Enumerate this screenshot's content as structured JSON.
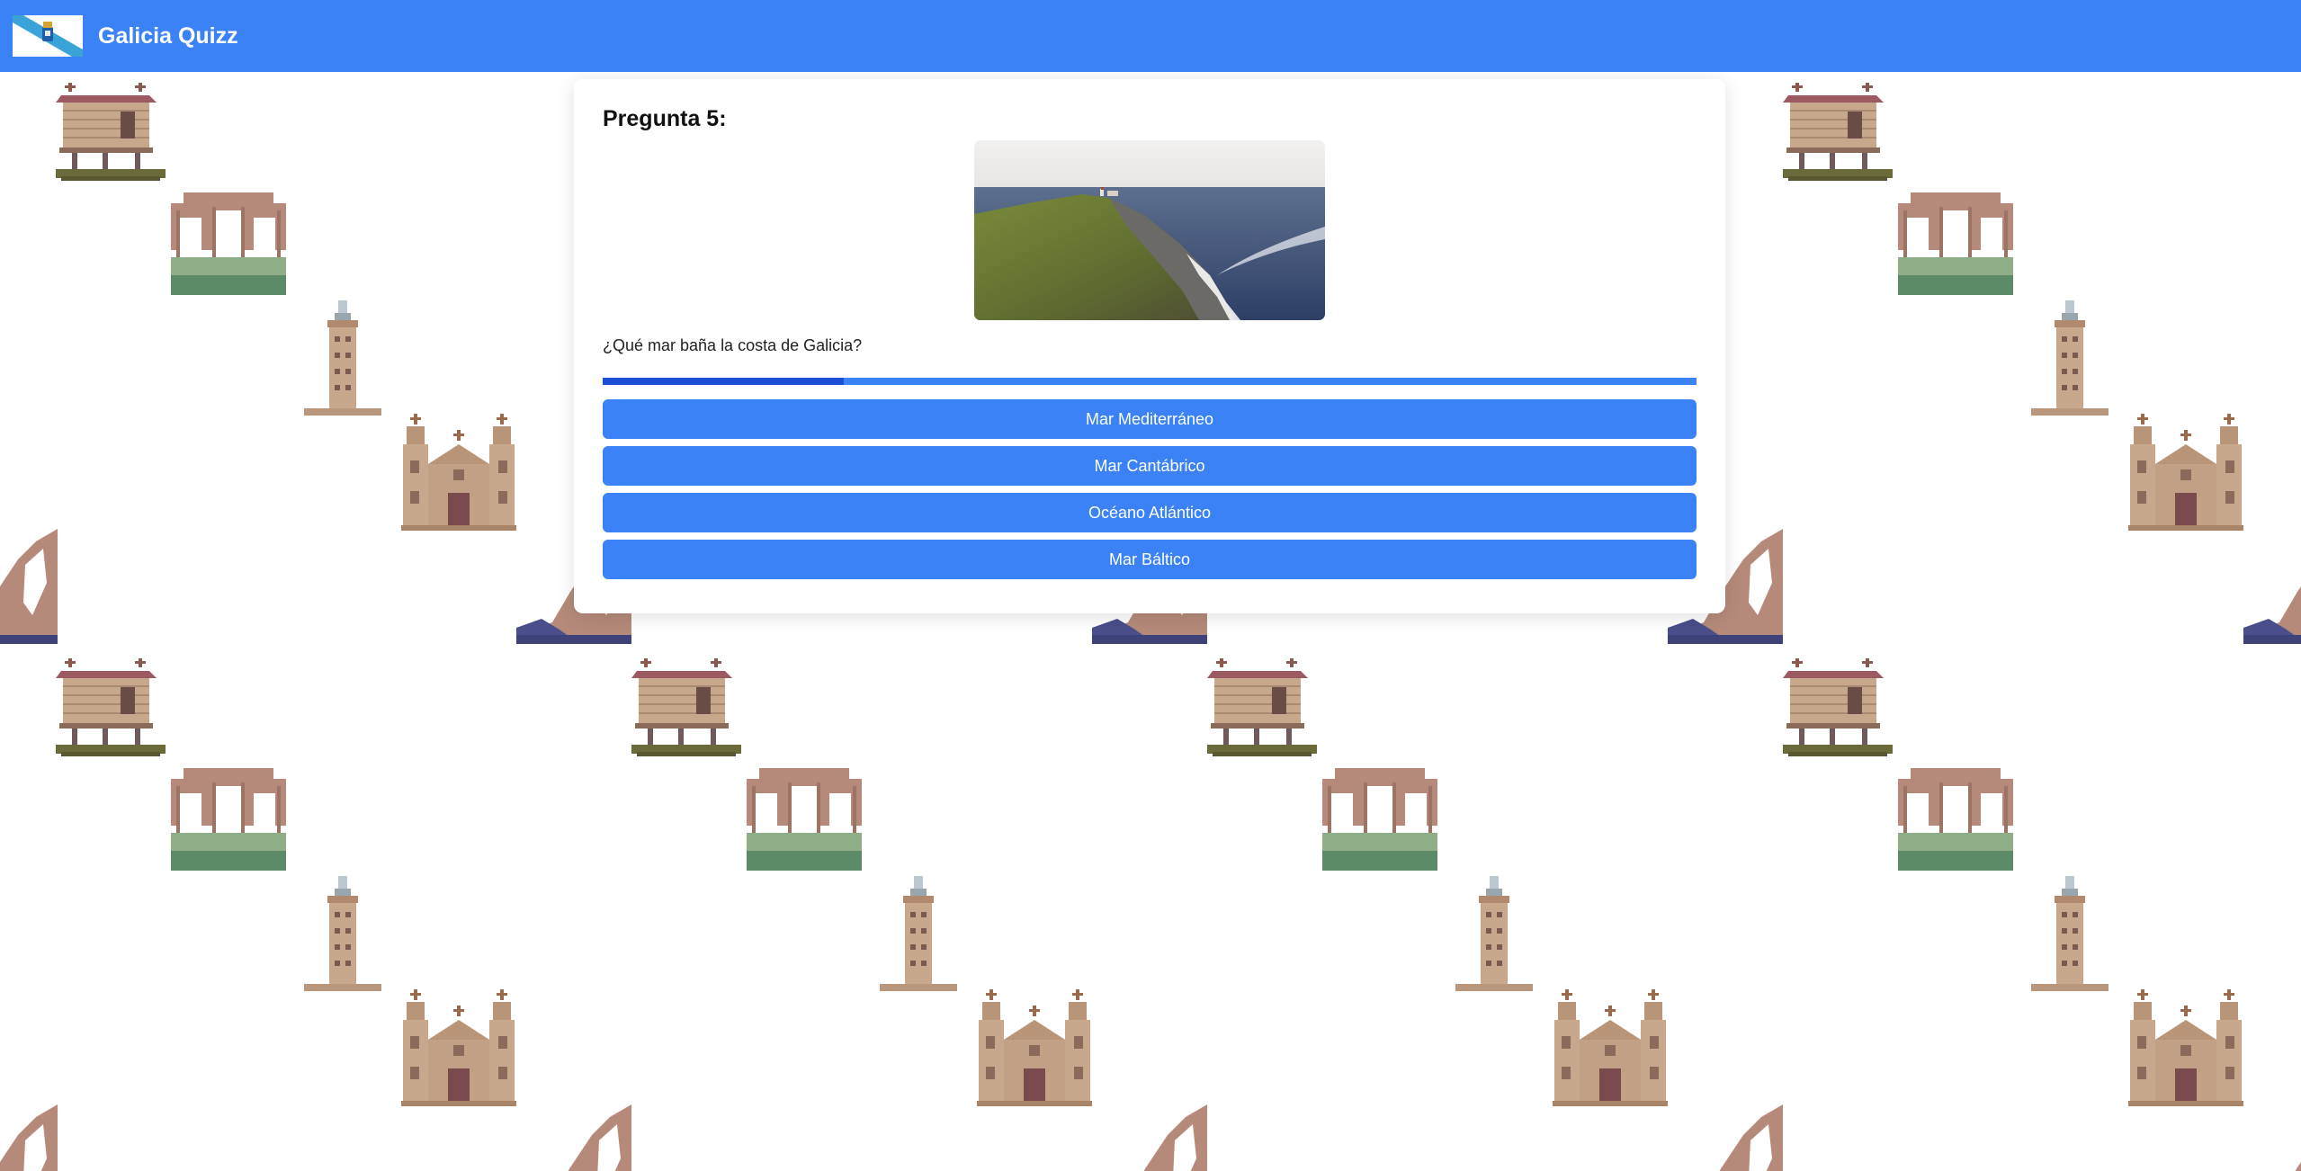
{
  "header": {
    "title": "Galicia Quizz",
    "flag_icon": "galicia-flag-icon",
    "color": "#3b82f6"
  },
  "quiz": {
    "question_title": "Pregunta 5:",
    "question_text": "¿Qué mar baña la costa de Galicia?",
    "image_icon": "coastal-cliff-lighthouse-photo",
    "progress_fraction": 0.22,
    "answers": [
      "Mar Mediterráneo",
      "Mar Cantábrico",
      "Océano Atlántico",
      "Mar Báltico"
    ],
    "accent_color": "#3b82f6",
    "progress_color": "#1d4ed8"
  },
  "background": {
    "icons": [
      "horreo-icon",
      "ruin-arches-icon",
      "tower-of-hercules-icon",
      "cathedral-icon",
      "shell-icon"
    ]
  }
}
